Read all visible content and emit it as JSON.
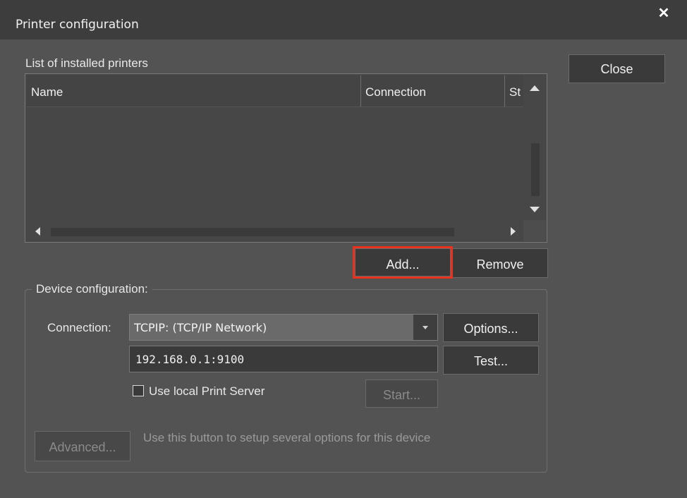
{
  "window": {
    "title": "Printer configuration",
    "close_glyph": "✕"
  },
  "list": {
    "label": "List of installed printers",
    "columns": [
      "Name",
      "Connection",
      "St"
    ],
    "rows": []
  },
  "buttons": {
    "close": "Close",
    "add": "Add...",
    "remove": "Remove",
    "options": "Options...",
    "test": "Test...",
    "start": "Start...",
    "advanced": "Advanced..."
  },
  "device": {
    "group_title": "Device configuration:",
    "connection_label": "Connection:",
    "connection_value": "TCPIP: (TCP/IP Network)",
    "address_value": "192.168.0.1:9100",
    "local_server_label": "Use local Print Server",
    "local_server_checked": false,
    "advanced_hint": "Use this button to setup several options for this device"
  },
  "colors": {
    "highlight": "#e8321e",
    "background": "#535353",
    "titlebar": "#3d3d3d"
  }
}
